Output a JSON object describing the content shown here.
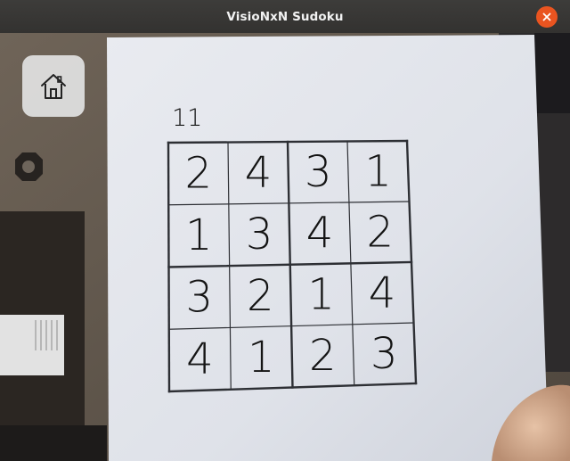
{
  "window": {
    "title": "VisioNxN Sudoku"
  },
  "home_button": {
    "icon": "home-icon"
  },
  "close_button": {
    "icon": "close-icon",
    "color": "#e95420"
  },
  "puzzle_card": {
    "label": "11",
    "size": 4,
    "grid": [
      [
        "2",
        "4",
        "3",
        "1"
      ],
      [
        "1",
        "3",
        "4",
        "2"
      ],
      [
        "3",
        "2",
        "1",
        "4"
      ],
      [
        "4",
        "1",
        "2",
        "3"
      ]
    ]
  }
}
